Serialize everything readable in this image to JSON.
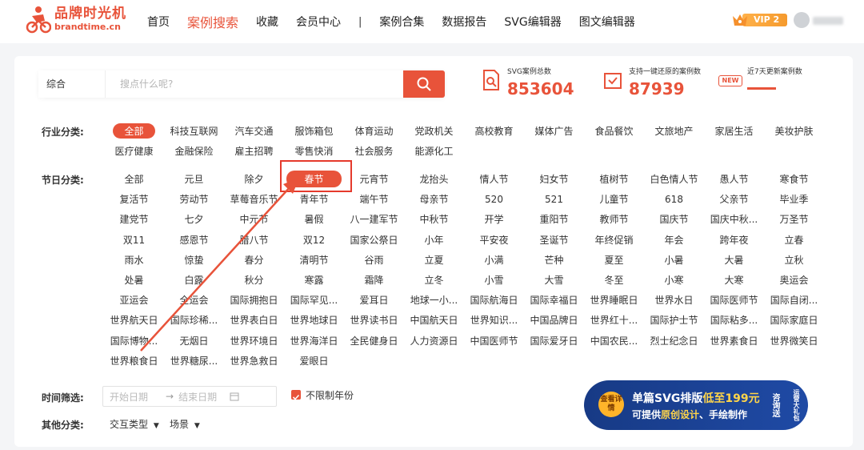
{
  "header": {
    "logo_cn": "品牌时光机",
    "logo_en": "brandtime.cn",
    "nav": [
      "首页",
      "案例搜索",
      "收藏",
      "会员中心"
    ],
    "nav_sep": "|",
    "nav2": [
      "案例合集",
      "数据报告",
      "SVG编辑器",
      "图文编辑器"
    ],
    "vip_label": "VIP 2"
  },
  "search": {
    "type": "综合",
    "placeholder": "搜点什么呢?"
  },
  "stats": [
    {
      "label": "SVG案例总数",
      "value": "853604"
    },
    {
      "label": "支持一键还原的案例数",
      "value": "87939"
    },
    {
      "label": "近7天更新案例数",
      "value": "",
      "badge": "NEW"
    }
  ],
  "industry": {
    "label": "行业分类:",
    "rows": [
      [
        "全部",
        "科技互联网",
        "汽车交通",
        "服饰箱包",
        "体育运动",
        "党政机关",
        "高校教育",
        "媒体广告",
        "食品餐饮",
        "文旅地产",
        "家居生活",
        "美妆护肤"
      ],
      [
        "医疗健康",
        "金融保险",
        "雇主招聘",
        "零售快消",
        "社会服务",
        "能源化工"
      ]
    ]
  },
  "festival": {
    "label": "节日分类:",
    "rows": [
      [
        "全部",
        "元旦",
        "除夕",
        "春节",
        "元宵节",
        "龙抬头",
        "情人节",
        "妇女节",
        "植树节",
        "白色情人节",
        "愚人节",
        "寒食节"
      ],
      [
        "复活节",
        "劳动节",
        "草莓音乐节",
        "青年节",
        "端午节",
        "母亲节",
        "520",
        "521",
        "儿童节",
        "618",
        "父亲节",
        "毕业季"
      ],
      [
        "建党节",
        "七夕",
        "中元节",
        "暑假",
        "八一建军节",
        "中秋节",
        "开学",
        "重阳节",
        "教师节",
        "国庆节",
        "国庆中秋...",
        "万圣节"
      ],
      [
        "双11",
        "感恩节",
        "腊八节",
        "双12",
        "国家公祭日",
        "小年",
        "平安夜",
        "圣诞节",
        "年终促销",
        "年会",
        "跨年夜",
        "立春"
      ],
      [
        "雨水",
        "惊蛰",
        "春分",
        "清明节",
        "谷雨",
        "立夏",
        "小满",
        "芒种",
        "夏至",
        "小暑",
        "大暑",
        "立秋"
      ],
      [
        "处暑",
        "白露",
        "秋分",
        "寒露",
        "霜降",
        "立冬",
        "小雪",
        "大雪",
        "冬至",
        "小寒",
        "大寒",
        "奥运会"
      ],
      [
        "亚运会",
        "全运会",
        "国际拥抱日",
        "国际罕见...",
        "爱耳日",
        "地球一小...",
        "国际航海日",
        "国际幸福日",
        "世界睡眠日",
        "世界水日",
        "国际医师节",
        "国际自闭..."
      ],
      [
        "世界航天日",
        "国际珍稀...",
        "世界表白日",
        "世界地球日",
        "世界读书日",
        "中国航天日",
        "世界知识...",
        "中国品牌日",
        "世界红十...",
        "国际护士节",
        "国际粘多...",
        "国际家庭日"
      ],
      [
        "国际博物...",
        "无烟日",
        "世界环境日",
        "世界海洋日",
        "全民健身日",
        "人力资源日",
        "中国医师节",
        "国际爱牙日",
        "中国农民...",
        "烈士纪念日",
        "世界素食日",
        "世界微笑日"
      ],
      [
        "世界粮食日",
        "世界糖尿...",
        "世界急救日",
        "爱眼日"
      ]
    ]
  },
  "time_filter": {
    "label": "时间筛选:",
    "start_placeholder": "开始日期",
    "arrow": "→",
    "end_placeholder": "结束日期",
    "no_limit": "不限制年份"
  },
  "other": {
    "label": "其他分类:",
    "dropdowns": [
      "交互类型",
      "场景"
    ]
  },
  "banner": {
    "button": "查看详情",
    "title_a": "单篇SVG排版",
    "title_b": "低至199元",
    "sub_a": "可提供",
    "sub_b": "原创设计",
    "sub_c": "、手绘制作",
    "side": "咨询送",
    "side2": "运营大礼包"
  },
  "colors": {
    "accent": "#e8533a",
    "banner": "#1f4aa5",
    "highlight": "#e53a2c"
  }
}
